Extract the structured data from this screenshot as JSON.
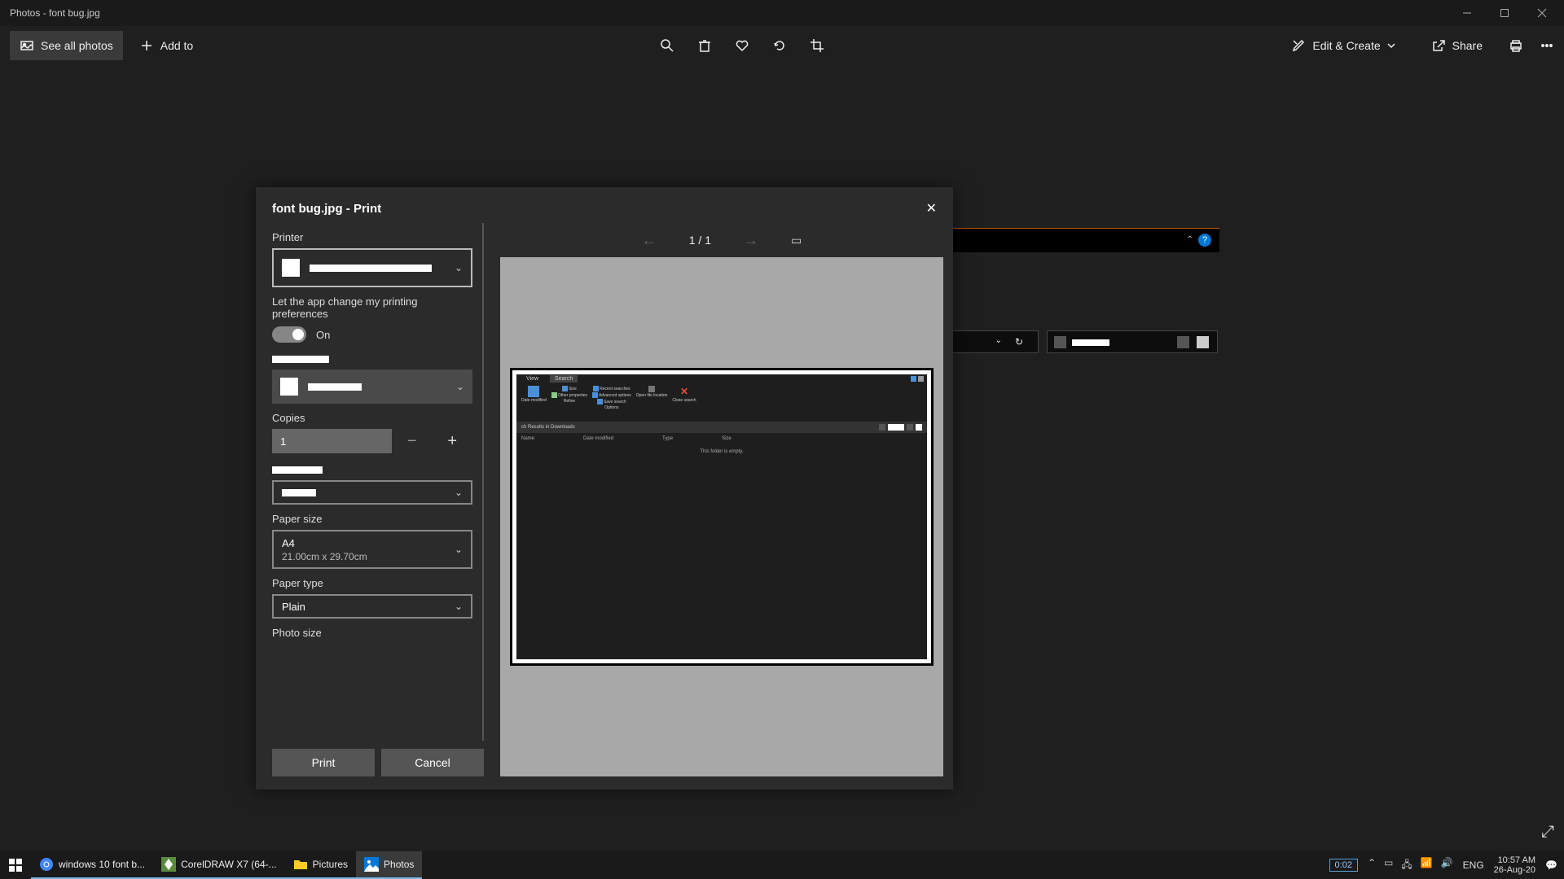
{
  "titlebar": {
    "text": "Photos - font bug.jpg"
  },
  "cmdbar": {
    "see_all": "See all photos",
    "add_to": "Add to",
    "edit_create": "Edit & Create",
    "share": "Share"
  },
  "dialog": {
    "title": "font bug.jpg - Print",
    "printer_label": "Printer",
    "app_change_label": "Let the app change my printing preferences",
    "toggle_state": "On",
    "copies_label": "Copies",
    "copies_value": "1",
    "paper_size_label": "Paper size",
    "paper_size_value": "A4",
    "paper_size_sub": "21.00cm x 29.70cm",
    "paper_type_label": "Paper type",
    "paper_type_value": "Plain",
    "photo_size_label": "Photo size",
    "print_btn": "Print",
    "cancel_btn": "Cancel",
    "page_nav": "1  /  1"
  },
  "preview": {
    "tab_view": "View",
    "tab_search": "Search",
    "ribbon_date": "Date modified",
    "ribbon_size": "Size",
    "ribbon_recent": "Recent searches",
    "ribbon_adv": "Advanced options",
    "ribbon_other": "Other properties",
    "ribbon_save": "Save search",
    "ribbon_open": "Open file location",
    "ribbon_close": "Close search",
    "ribbon_refine": "Refine",
    "ribbon_options": "Options",
    "breadcrumb": "ch Results in Downloads",
    "col_name": "Name",
    "col_date": "Date modified",
    "col_type": "Type",
    "col_size": "Size",
    "empty": "This folder is empty."
  },
  "taskbar": {
    "items": [
      {
        "label": "windows 10 font b..."
      },
      {
        "label": "CorelDRAW X7 (64-..."
      },
      {
        "label": "Pictures"
      },
      {
        "label": "Photos"
      }
    ],
    "record": "0:02",
    "lang": "ENG",
    "time": "10:57 AM",
    "date": "26-Aug-20"
  }
}
